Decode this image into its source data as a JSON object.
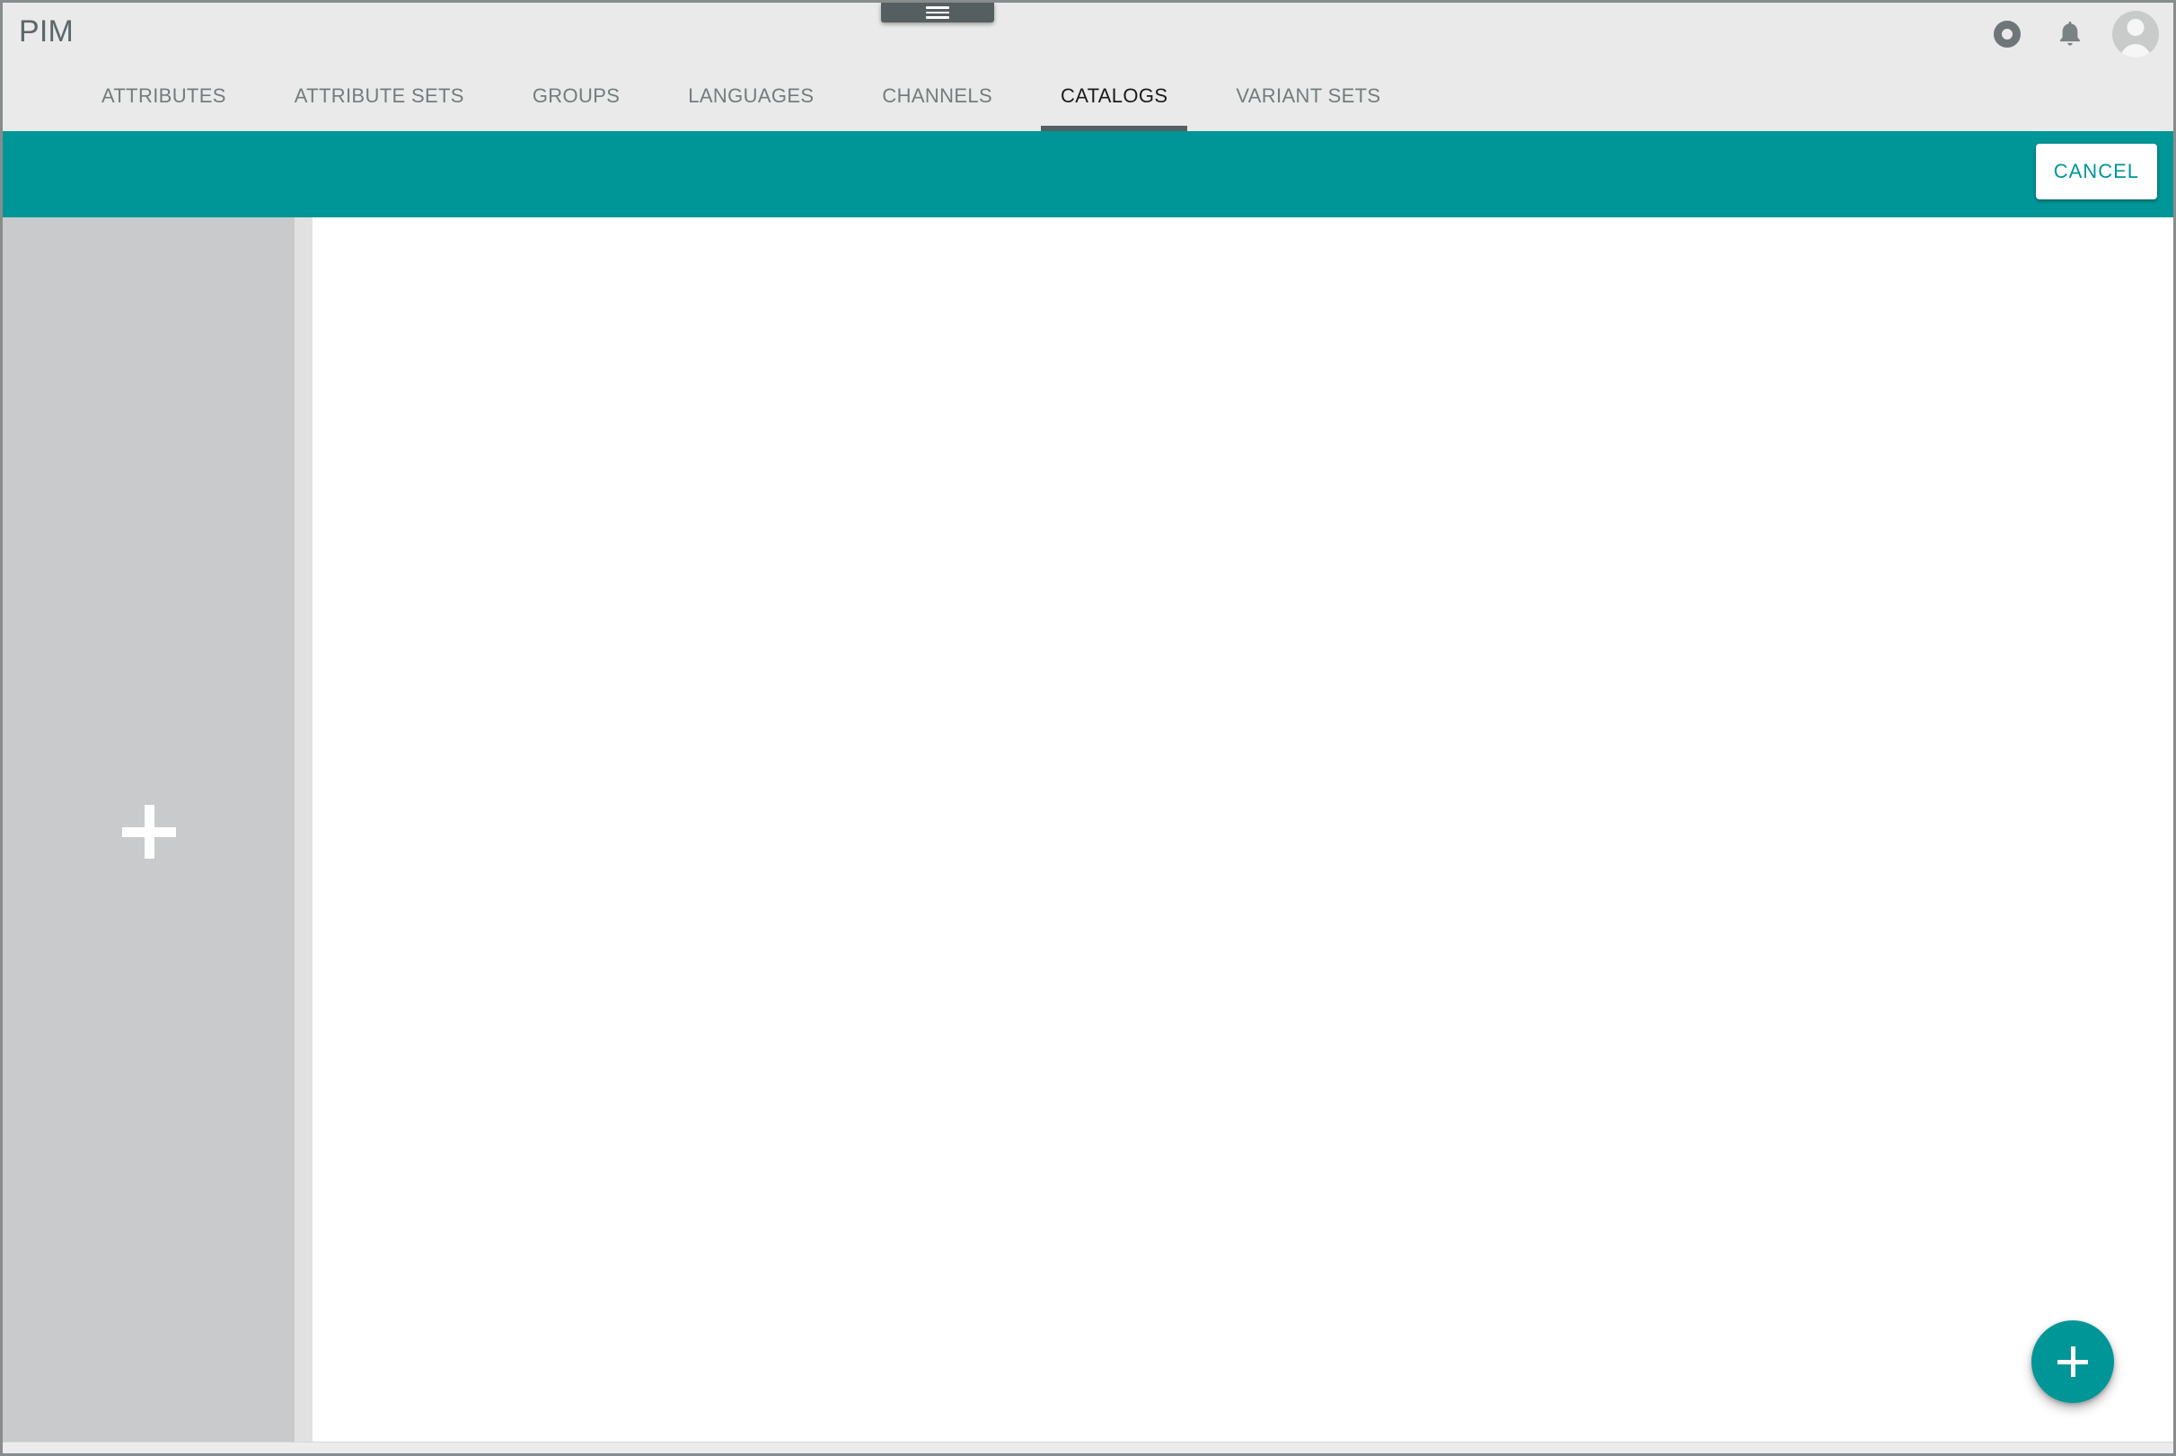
{
  "window": {
    "drag_handle_icon": "hamburger-icon"
  },
  "header": {
    "title": "PIM",
    "actions": [
      {
        "name": "status-ring-icon",
        "label": ""
      },
      {
        "name": "notifications-bell-icon",
        "label": ""
      },
      {
        "name": "user-avatar",
        "label": ""
      }
    ]
  },
  "tabs": [
    {
      "label": "ATTRIBUTES",
      "key": "attributes",
      "active": false
    },
    {
      "label": "ATTRIBUTE SETS",
      "key": "attribute-sets",
      "active": false
    },
    {
      "label": "GROUPS",
      "key": "groups",
      "active": false
    },
    {
      "label": "LANGUAGES",
      "key": "languages",
      "active": false
    },
    {
      "label": "CHANNELS",
      "key": "channels",
      "active": false
    },
    {
      "label": "CATALOGS",
      "key": "catalogs",
      "active": true
    },
    {
      "label": "VARIANT SETS",
      "key": "variant-sets",
      "active": false
    }
  ],
  "action_bar": {
    "cancel_label": "CANCEL",
    "background_color": "#009698"
  },
  "content": {
    "add_panel": {
      "icon": "plus-icon"
    },
    "catalog_list_items": []
  },
  "fab": {
    "icon": "plus-icon",
    "color": "#009698"
  },
  "colors": {
    "accent_teal": "#009698",
    "header_gray": "#eaeaea",
    "panel_gray": "#c8cacb",
    "divider_gray": "#e1e1e1",
    "active_tab_underline": "#546063"
  }
}
